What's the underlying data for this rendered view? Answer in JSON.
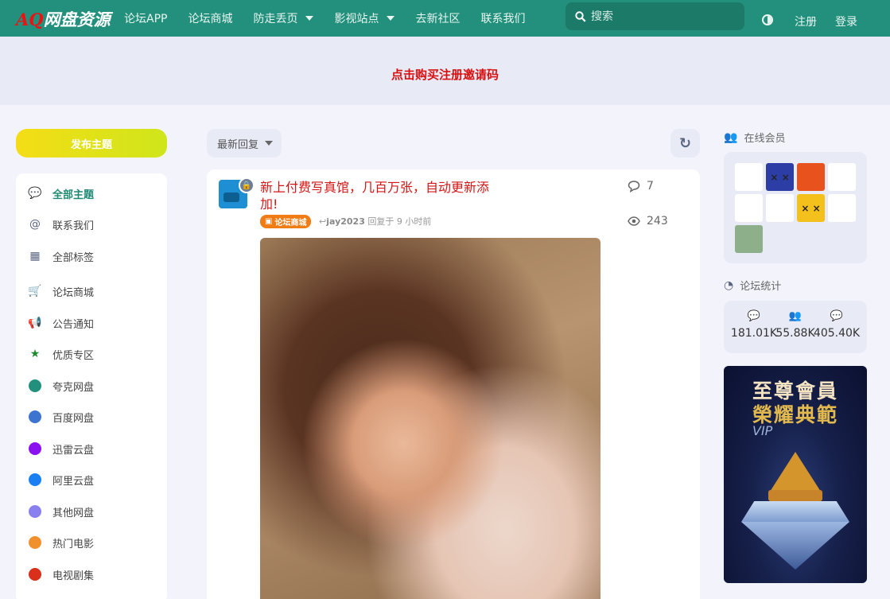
{
  "header": {
    "logo_text_aq": "AQ",
    "logo_text": "网盘资源",
    "nav": [
      {
        "label": "论坛APP",
        "dropdown": false
      },
      {
        "label": "论坛商城",
        "dropdown": false
      },
      {
        "label": "防走丢页",
        "dropdown": true
      },
      {
        "label": "影视站点",
        "dropdown": true
      },
      {
        "label": "去新社区",
        "dropdown": false
      },
      {
        "label": "联系我们",
        "dropdown": false
      }
    ],
    "search_placeholder": "搜索",
    "register": "注册",
    "login": "登录",
    "bg_color": "#22907c"
  },
  "banner": {
    "link_text": "点击购买注册邀请码",
    "link_color": "#d81010"
  },
  "sidebar": {
    "post_button": "发布主题",
    "items": [
      {
        "label": "全部主题",
        "icon": "comments-icon",
        "active": true
      },
      {
        "label": "联系我们",
        "icon": "at-icon"
      },
      {
        "label": "全部标签",
        "icon": "grid-icon"
      },
      {
        "label": "论坛商城",
        "icon": "cart-icon",
        "color": "#f07b12"
      },
      {
        "label": "公告通知",
        "icon": "megaphone-icon",
        "color": "#d81010"
      },
      {
        "label": "优质专区",
        "icon": "star-icon",
        "color": "#1d8a2f"
      },
      {
        "label": "夸克网盘",
        "icon": "dot-icon",
        "color": "#22907c"
      },
      {
        "label": "百度网盘",
        "icon": "dot-icon",
        "color": "#3d74d0"
      },
      {
        "label": "迅雷云盘",
        "icon": "dot-icon",
        "color": "#8b12f0"
      },
      {
        "label": "阿里云盘",
        "icon": "dot-icon",
        "color": "#1a7ff0"
      },
      {
        "label": "其他网盘",
        "icon": "dot-icon",
        "color": "#8b80f0"
      },
      {
        "label": "热门电影",
        "icon": "dot-icon",
        "color": "#f0912e"
      },
      {
        "label": "电视剧集",
        "icon": "dot-icon",
        "color": "#d8301a"
      }
    ]
  },
  "main": {
    "sort_label": "最新回复",
    "post": {
      "title": "新上付费写真馆，几百万张，自动更新添加!",
      "tag": "论坛商城",
      "author": "jay2023",
      "reply_text": "回复于 9 小时前",
      "comments": "7",
      "views": "243"
    }
  },
  "right": {
    "online_title": "在线会员",
    "stats_title": "论坛统计",
    "stats": [
      {
        "icon": "comments-icon",
        "value": "181.01K"
      },
      {
        "icon": "users-icon",
        "value": "55.88K"
      },
      {
        "icon": "comment-icon",
        "value": "405.40K"
      }
    ],
    "members": [
      {
        "icon": "sketch-avatar",
        "bg": "#ffffff",
        "text": ""
      },
      {
        "icon": "robot-avatar",
        "bg": "#2c3ea5",
        "text": "× ×"
      },
      {
        "icon": "mecha-avatar",
        "bg": "#e8521c",
        "text": ""
      },
      {
        "icon": "pig-avatar",
        "bg": "#ffffff",
        "text": ""
      },
      {
        "icon": "bear-avatar",
        "bg": "#ffffff",
        "text": ""
      },
      {
        "icon": "boy-avatar",
        "bg": "#ffffff",
        "text": ""
      },
      {
        "icon": "emoji-avatar",
        "bg": "#f4c11c",
        "text": "× ×"
      },
      {
        "icon": "duck-avatar",
        "bg": "#ffffff",
        "text": ""
      },
      {
        "icon": "bear-brown-avatar",
        "bg": "#8db08a",
        "text": ""
      }
    ],
    "vip": {
      "line1": "至尊會員",
      "line2": "榮耀典範",
      "sub": "VIP"
    }
  }
}
